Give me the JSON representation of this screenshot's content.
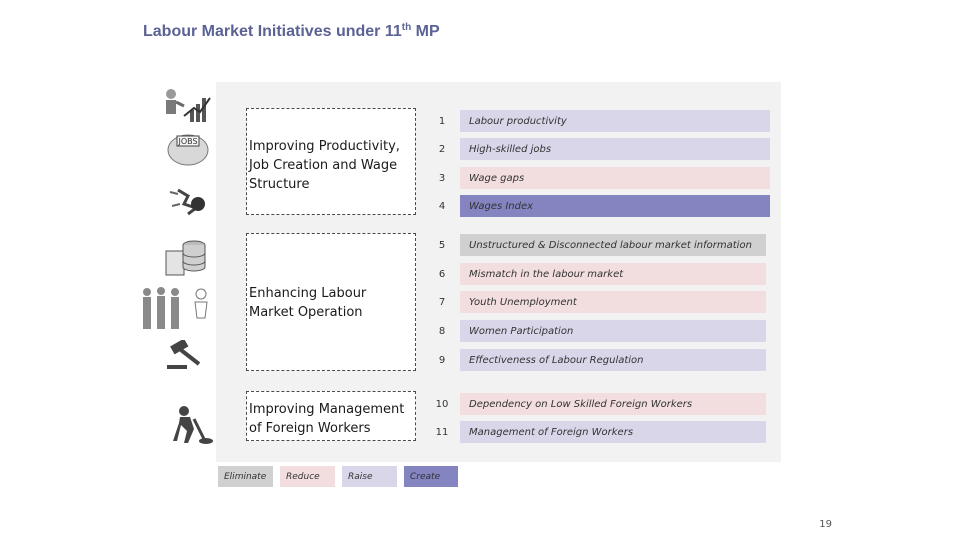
{
  "title": {
    "main": "Labour Market Initiatives under 11",
    "sup": "th",
    "tail": " MP"
  },
  "groups": [
    {
      "line1": "Improving Productivity,",
      "line2": "Job Creation and Wage",
      "line3": "Structure"
    },
    {
      "line1": "Enhancing Labour",
      "line2": "Market Operation"
    },
    {
      "line1": "Improving Management",
      "line2": "of Foreign Workers"
    }
  ],
  "items": [
    {
      "num": "1",
      "label": "Labour productivity",
      "category": "Raise",
      "color": "#d9d6ea"
    },
    {
      "num": "2",
      "label": "High-skilled jobs",
      "category": "Raise",
      "color": "#d9d6ea"
    },
    {
      "num": "3",
      "label": "Wage gaps",
      "category": "Reduce",
      "color": "#f2dede"
    },
    {
      "num": "4",
      "label": "Wages Index",
      "category": "Create",
      "color": "#8484c0"
    },
    {
      "num": "5",
      "label": "Unstructured & Disconnected labour market information",
      "category": "Eliminate",
      "color": "#d0d0d0"
    },
    {
      "num": "6",
      "label": "Mismatch in the labour market",
      "category": "Reduce",
      "color": "#f2dede"
    },
    {
      "num": "7",
      "label": "Youth Unemployment",
      "category": "Reduce",
      "color": "#f2dede"
    },
    {
      "num": "8",
      "label": "Women Participation",
      "category": "Raise",
      "color": "#d9d6ea"
    },
    {
      "num": "9",
      "label": "Effectiveness of Labour Regulation",
      "category": "Raise",
      "color": "#d9d6ea"
    },
    {
      "num": "10",
      "label": "Dependency on Low Skilled Foreign Workers",
      "category": "Reduce",
      "color": "#f2dede"
    },
    {
      "num": "11",
      "label": "Management of Foreign Workers",
      "category": "Raise",
      "color": "#d9d6ea"
    }
  ],
  "legend": [
    {
      "label": "Eliminate",
      "color": "#d0d0d0"
    },
    {
      "label": "Reduce",
      "color": "#f2dede"
    },
    {
      "label": "Raise",
      "color": "#d9d6ea"
    },
    {
      "label": "Create",
      "color": "#8484c0"
    }
  ],
  "icons": [
    "businessman-growth-chart-icon",
    "jobs-globe-icon",
    "broken-wall-icon",
    "database-clipboard-icon",
    "people-group-icon",
    "gavel-icon",
    "worker-digging-icon"
  ],
  "page_number": "19"
}
